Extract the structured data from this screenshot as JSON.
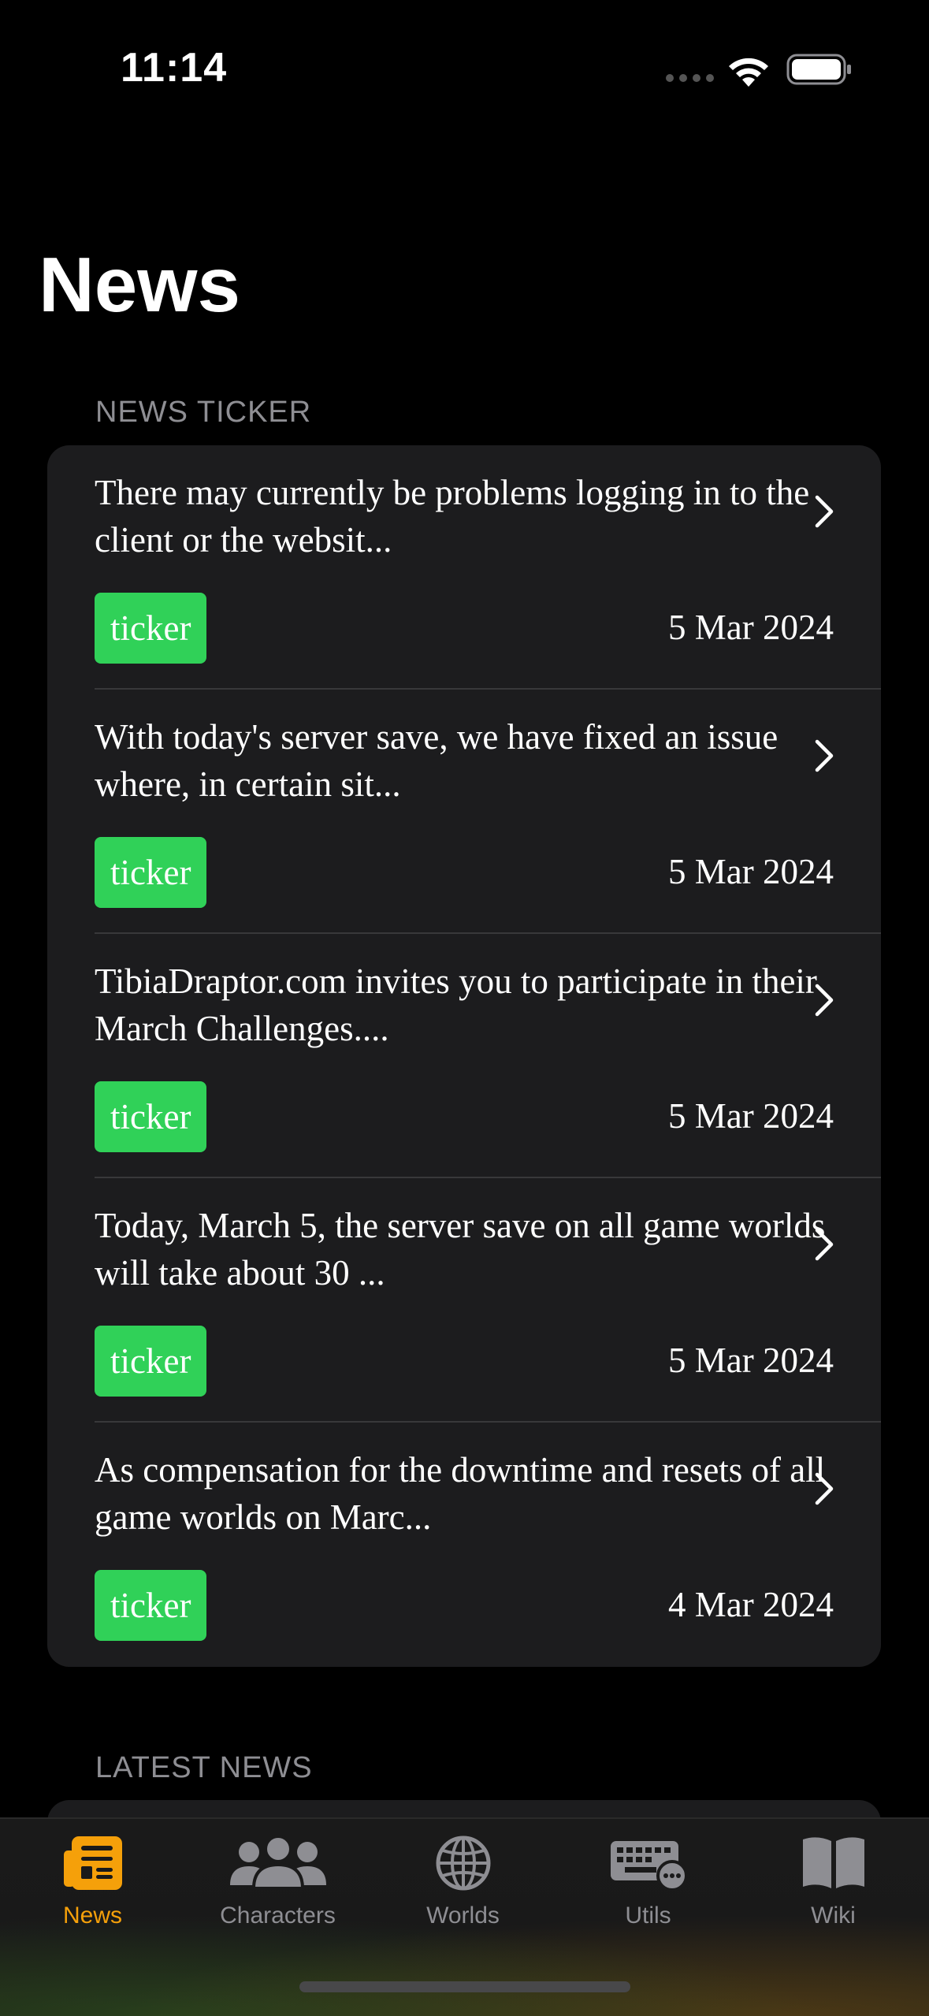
{
  "status_bar": {
    "time": "11:14"
  },
  "page": {
    "title": "News"
  },
  "news_ticker": {
    "header": "NEWS TICKER",
    "items": [
      {
        "headline": "There may currently be problems logging in to the client or the websit...",
        "tag": "ticker",
        "date": "5 Mar 2024"
      },
      {
        "headline": "With today's server save, we have fixed an issue where, in certain sit...",
        "tag": "ticker",
        "date": "5 Mar 2024"
      },
      {
        "headline": "TibiaDraptor.com invites you to participate in their March Challenges....",
        "tag": "ticker",
        "date": "5 Mar 2024"
      },
      {
        "headline": "Today, March 5, the server save on all game worlds will take about 30 ...",
        "tag": "ticker",
        "date": "5 Mar 2024"
      },
      {
        "headline": "As compensation for the downtime and resets of all game worlds on Marc...",
        "tag": "ticker",
        "date": "4 Mar 2024"
      }
    ]
  },
  "latest_news": {
    "header": "LATEST NEWS"
  },
  "tab_bar": {
    "tabs": [
      {
        "label": "News",
        "icon": "newspaper-icon",
        "active": true
      },
      {
        "label": "Characters",
        "icon": "people-icon",
        "active": false
      },
      {
        "label": "Worlds",
        "icon": "globe-icon",
        "active": false
      },
      {
        "label": "Utils",
        "icon": "keyboard-icon",
        "active": false
      },
      {
        "label": "Wiki",
        "icon": "book-icon",
        "active": false
      }
    ]
  },
  "colors": {
    "accent": "#f5a00a",
    "tag_green": "#30d158",
    "card": "#1c1c1e",
    "secondary_text": "#8e8e93"
  }
}
